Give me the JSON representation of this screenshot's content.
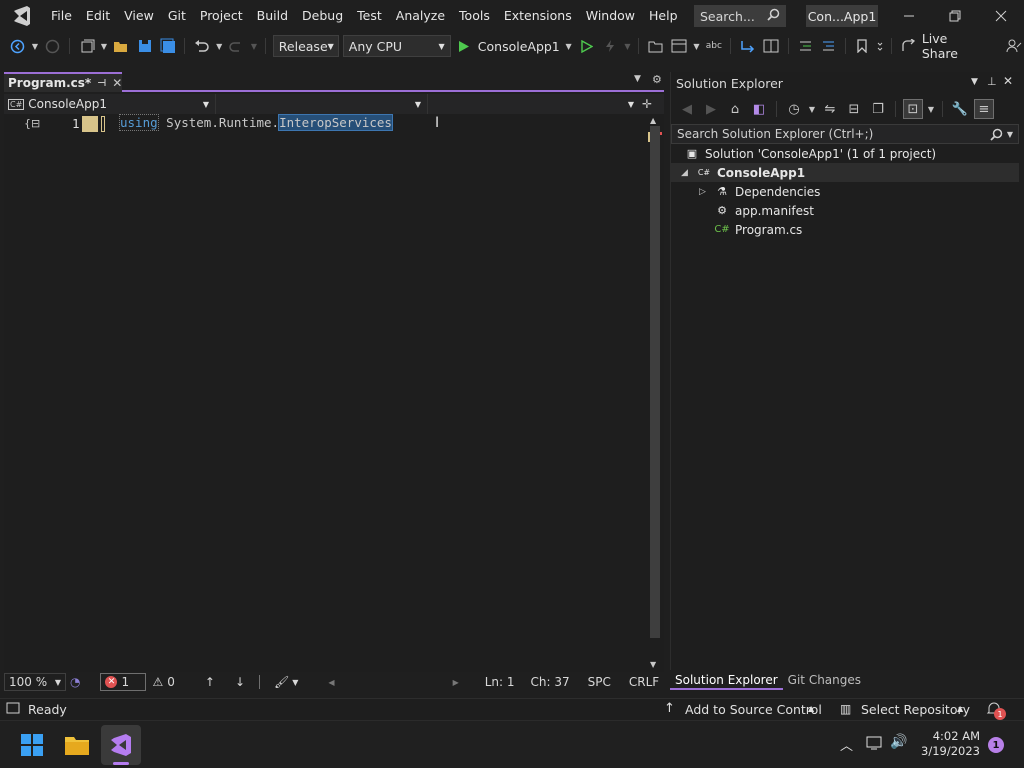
{
  "menu": {
    "items": [
      "File",
      "Edit",
      "View",
      "Git",
      "Project",
      "Build",
      "Debug",
      "Test",
      "Analyze",
      "Tools",
      "Extensions",
      "Window",
      "Help"
    ],
    "search_label": "Search...",
    "project_badge": "Con...App1"
  },
  "toolbar": {
    "configuration": "Release",
    "platform": "Any CPU",
    "start_target": "ConsoleApp1",
    "live_share": "Live Share"
  },
  "editor": {
    "tab_label": "Program.cs*",
    "nav_project": "ConsoleApp1",
    "line_number": "1",
    "code": {
      "keyword": "using",
      "namespace": " System.Runtime.",
      "selected": "InteropServices"
    },
    "status": {
      "zoom": "100 %",
      "errors": "1",
      "warnings": "0",
      "line": "Ln: 1",
      "column": "Ch: 37",
      "whitespace": "SPC",
      "line_ending": "CRLF"
    }
  },
  "solution_explorer": {
    "title": "Solution Explorer",
    "search_placeholder": "Search Solution Explorer (Ctrl+;)",
    "tree": {
      "solution": "Solution 'ConsoleApp1' (1 of 1 project)",
      "project": "ConsoleApp1",
      "dependencies": "Dependencies",
      "manifest": "app.manifest",
      "program": "Program.cs"
    },
    "tabs": [
      "Solution Explorer",
      "Git Changes"
    ]
  },
  "statusbar": {
    "ready": "Ready",
    "source_control": "Add to Source Control",
    "repository": "Select Repository",
    "notification_count": "1"
  },
  "taskbar": {
    "time": "4:02 AM",
    "date": "3/19/2023",
    "notification_count": "1"
  },
  "colors": {
    "accent": "#9c6fd6",
    "keyword": "#569cd6",
    "selection": "#264f78",
    "error": "#e05252",
    "play": "#4ec94e"
  }
}
